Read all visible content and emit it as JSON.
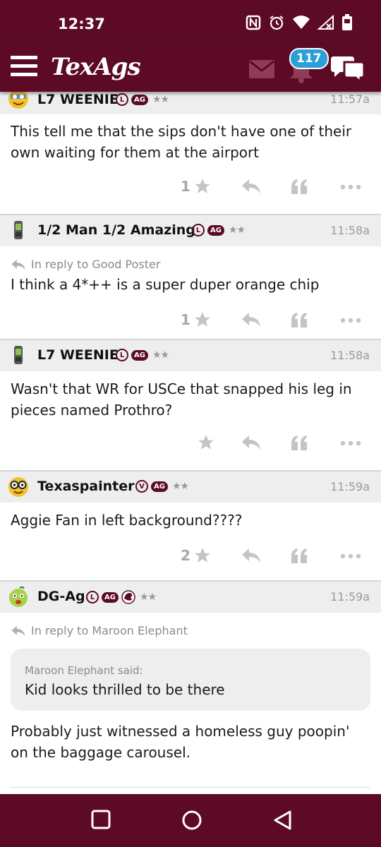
{
  "status": {
    "time": "12:37"
  },
  "app": {
    "logo": "TexAgs",
    "notification_count": "117"
  },
  "posts": [
    {
      "username": "L7 WEENIE",
      "badges": [
        "L",
        "AG"
      ],
      "time": "11:57a",
      "reply_to": "",
      "quote_author": "",
      "quote_text": "",
      "body": "This tell me that the sips don't have one of their own waiting for them at the airport",
      "likes": "1"
    },
    {
      "username": "1/2 Man 1/2 Amazing",
      "badges": [
        "L",
        "AG"
      ],
      "time": "11:58a",
      "reply_to": "In reply to Good Poster",
      "quote_author": "",
      "quote_text": "",
      "body": "I think a 4*++ is a super duper orange chip",
      "likes": "1"
    },
    {
      "username": "L7 WEENIE",
      "badges": [
        "L",
        "AG"
      ],
      "time": "11:58a",
      "reply_to": "",
      "quote_author": "",
      "quote_text": "",
      "body": "Wasn't that WR for USCe that snapped his leg in pieces named Prothro?",
      "likes": ""
    },
    {
      "username": "Texaspainter",
      "badges": [
        "V",
        "AG"
      ],
      "time": "11:59a",
      "reply_to": "",
      "quote_author": "",
      "quote_text": "",
      "body": "Aggie Fan in left background????",
      "likes": "2"
    },
    {
      "username": "DG-Ag",
      "badges": [
        "L",
        "AG"
      ],
      "time": "11:59a",
      "reply_to": "In reply to Maroon Elephant",
      "quote_author": "Maroon Elephant said:",
      "quote_text": "Kid looks thrilled to be there",
      "body": "Probably just witnessed a homeless guy poopin' on the baggage carousel.",
      "likes": ""
    }
  ],
  "colors": {
    "maroon": "#5c0a25",
    "badge_blue": "#2a9fd8"
  }
}
